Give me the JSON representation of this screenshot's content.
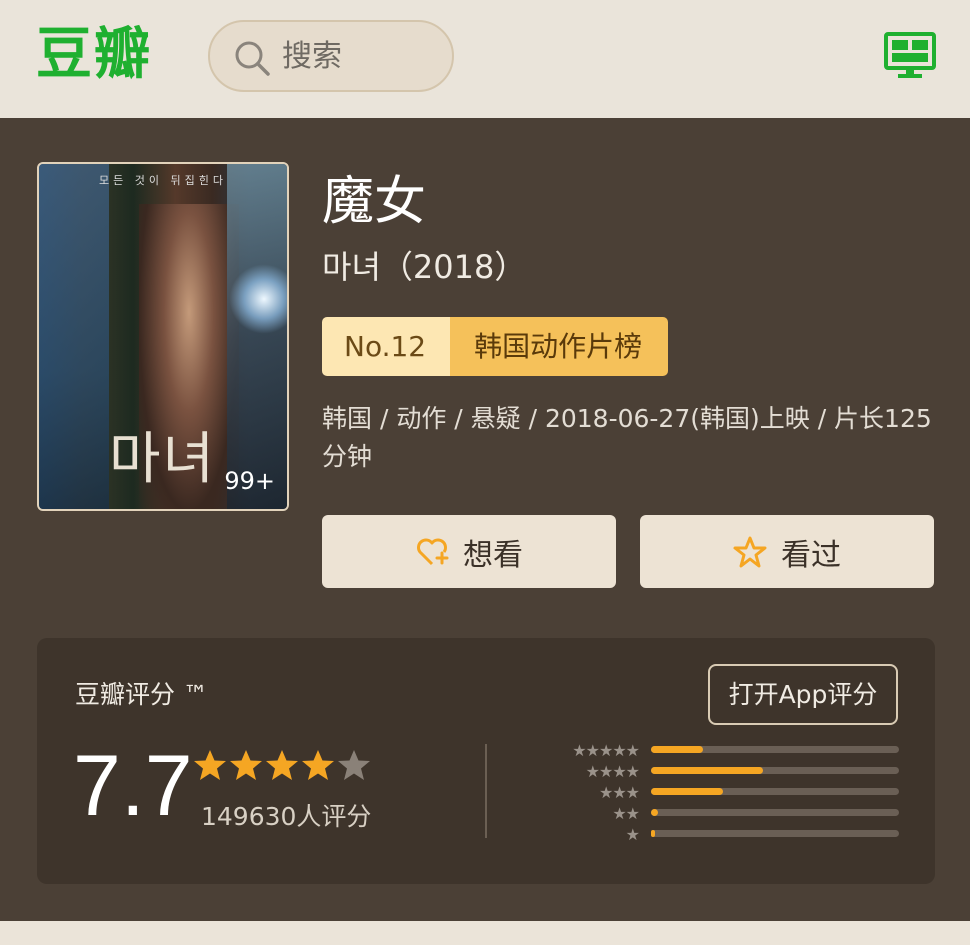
{
  "header": {
    "logo": "豆瓣",
    "search_placeholder": "搜索",
    "icons": [
      "search-icon",
      "tv-icon"
    ]
  },
  "movie": {
    "title": "魔女",
    "original_title": "마녀（2018）",
    "poster": {
      "top_text": "모든 것이 뒤집힌다",
      "title_text": "마녀",
      "badge": "99+"
    },
    "rank": {
      "no": "No.12",
      "name": "韩国动作片榜"
    },
    "meta": "韩国 / 动作 / 悬疑 / 2018-06-27(韩国)上映 / 片长125分钟",
    "buttons": {
      "want": "想看",
      "seen": "看过"
    },
    "colors": {
      "accent": "#f5a623",
      "brand": "#1fb030",
      "background": "#4b4036"
    }
  },
  "rating": {
    "title": "豆瓣评分 ™",
    "open_app": "打开App评分",
    "score": "7.7",
    "stars_filled": 4,
    "stars_total": 5,
    "count": "149630人评分",
    "distribution": [
      {
        "stars": "★★★★★",
        "fraction": 0.21
      },
      {
        "stars": "★★★★",
        "fraction": 0.45
      },
      {
        "stars": "★★★",
        "fraction": 0.29
      },
      {
        "stars": "★★",
        "fraction": 0.03
      },
      {
        "stars": "★",
        "fraction": 0.01
      }
    ]
  }
}
